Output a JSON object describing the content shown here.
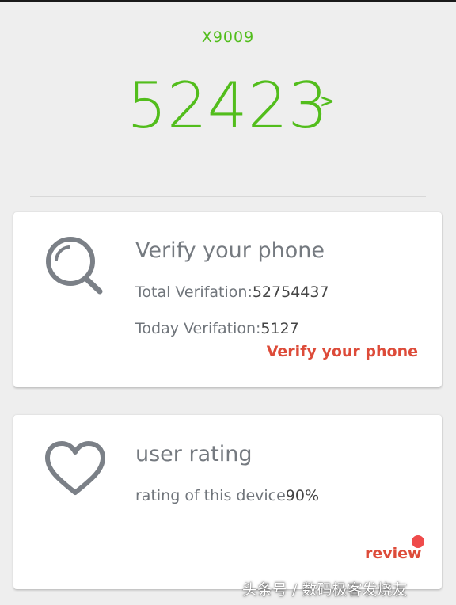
{
  "header": {
    "device_name": "X9009",
    "score": "52423",
    "score_arrow": ">"
  },
  "verify_card": {
    "icon": "search-icon",
    "title": "Verify your phone",
    "total_label": "Total Verifation:",
    "total_value": "52754437",
    "today_label": "Today Verifation:",
    "today_value": "5127",
    "link_label": "Verify your phone"
  },
  "rating_card": {
    "icon": "heart-icon",
    "title": "user rating",
    "rating_label": "rating of this device",
    "rating_value": "90%",
    "link_label": "review"
  },
  "watermark": "头条号 / 数码极客发烧友",
  "colors": {
    "score_green": "#52bd1c",
    "link_red": "#dd4b39",
    "icon_gray": "#7b8087",
    "background": "#eeeeee"
  }
}
